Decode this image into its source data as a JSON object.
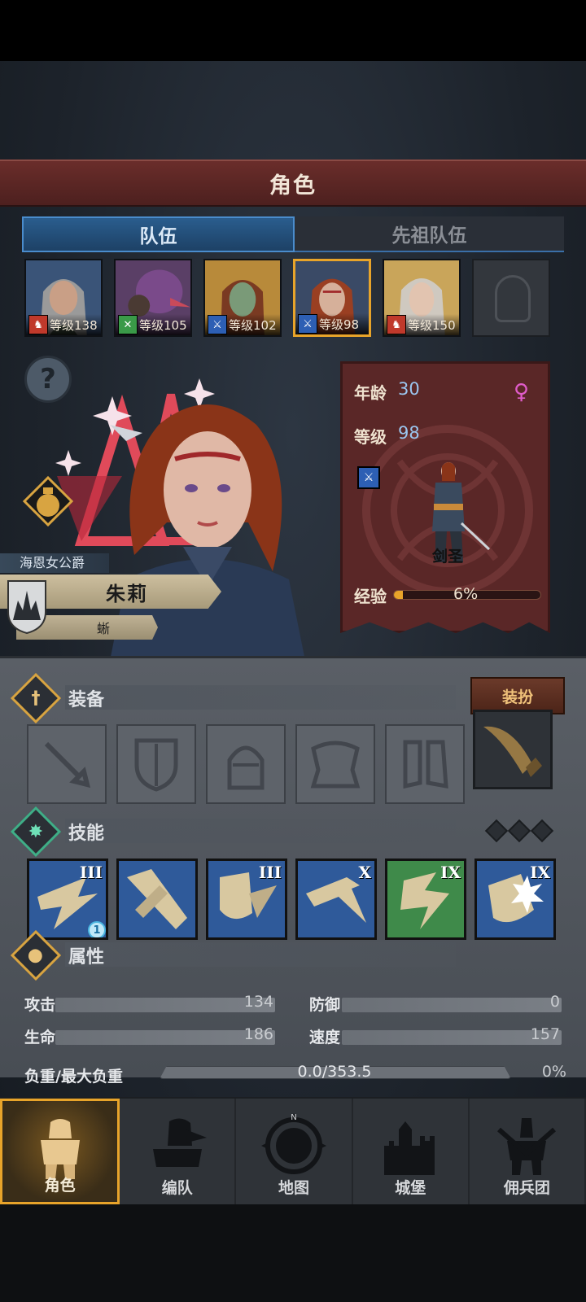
{
  "header": {
    "title": "角色"
  },
  "tabs": [
    {
      "label": "队伍"
    },
    {
      "label": "先祖队伍"
    }
  ],
  "team": [
    {
      "level": "等级138",
      "class_icon": "horse-icon",
      "badge_color": "#c0392b"
    },
    {
      "level": "等级105",
      "class_icon": "crossbow-icon",
      "badge_color": "#3a9a48"
    },
    {
      "level": "等级102",
      "class_icon": "sword-icon",
      "badge_color": "#2d5fb4"
    },
    {
      "level": "等级98",
      "class_icon": "sword-icon",
      "badge_color": "#2d5fb4"
    },
    {
      "level": "等级150",
      "class_icon": "horse-icon",
      "badge_color": "#c0392b"
    }
  ],
  "hero": {
    "title": "海恩女公爵",
    "name": "朱莉",
    "house": "蜥"
  },
  "info": {
    "age_label": "年龄",
    "age": "30",
    "level_label": "等级",
    "level": "98",
    "gender_symbol": "♀",
    "class_name": "剑圣",
    "exp_label": "经验",
    "exp_pct": "6%",
    "exp_fraction": 0.06
  },
  "equipment": {
    "title": "装备",
    "dress_button": "装扮",
    "slots": [
      "sword-icon",
      "shield-icon",
      "helmet-icon",
      "armor-icon",
      "boots-icon",
      "horn-icon"
    ]
  },
  "skills": {
    "title": "技能",
    "items": [
      {
        "rank": "III",
        "badge": "1",
        "color": "#2f5a9a"
      },
      {
        "rank": "",
        "color": "#2f5a9a"
      },
      {
        "rank": "III",
        "color": "#2f5a9a"
      },
      {
        "rank": "X",
        "color": "#2f5a9a"
      },
      {
        "rank": "IX",
        "color": "#3f8a4a"
      },
      {
        "rank": "IX",
        "color": "#2f5a9a"
      }
    ]
  },
  "attributes": {
    "title": "属性",
    "attack_label": "攻击",
    "attack": "134",
    "defense_label": "防御",
    "defense": "0",
    "hp_label": "生命",
    "hp": "186",
    "speed_label": "速度",
    "speed": "157",
    "load_label": "负重/最大负重",
    "load": "0.0/353.5",
    "load_pct": "0%"
  },
  "nav": [
    {
      "label": "角色"
    },
    {
      "label": "编队"
    },
    {
      "label": "地图"
    },
    {
      "label": "城堡"
    },
    {
      "label": "佣兵团"
    }
  ]
}
